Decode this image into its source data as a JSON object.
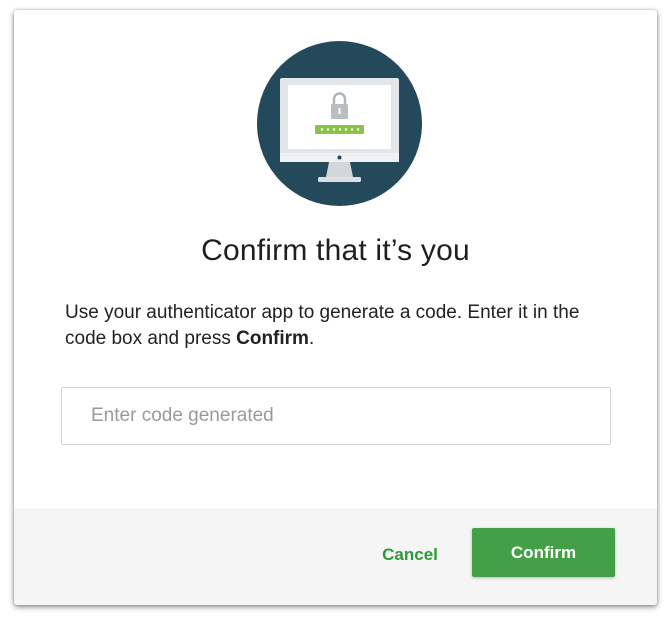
{
  "dialog": {
    "illustration_icon": "monitor-lock-icon",
    "title": "Confirm that it’s you",
    "instructions_text": "Use your authenticator app to generate a code. Enter it in the code box and press ",
    "instructions_emphasis": "Confirm",
    "instructions_end": ".",
    "code_input": {
      "placeholder": "Enter code generated",
      "value": ""
    }
  },
  "footer": {
    "cancel_label": "Cancel",
    "confirm_label": "Confirm"
  },
  "colors": {
    "accent_green": "#43a047",
    "link_green": "#2e9a35",
    "illustration_bg": "#24495a",
    "code_bar_green": "#8bc34a"
  }
}
